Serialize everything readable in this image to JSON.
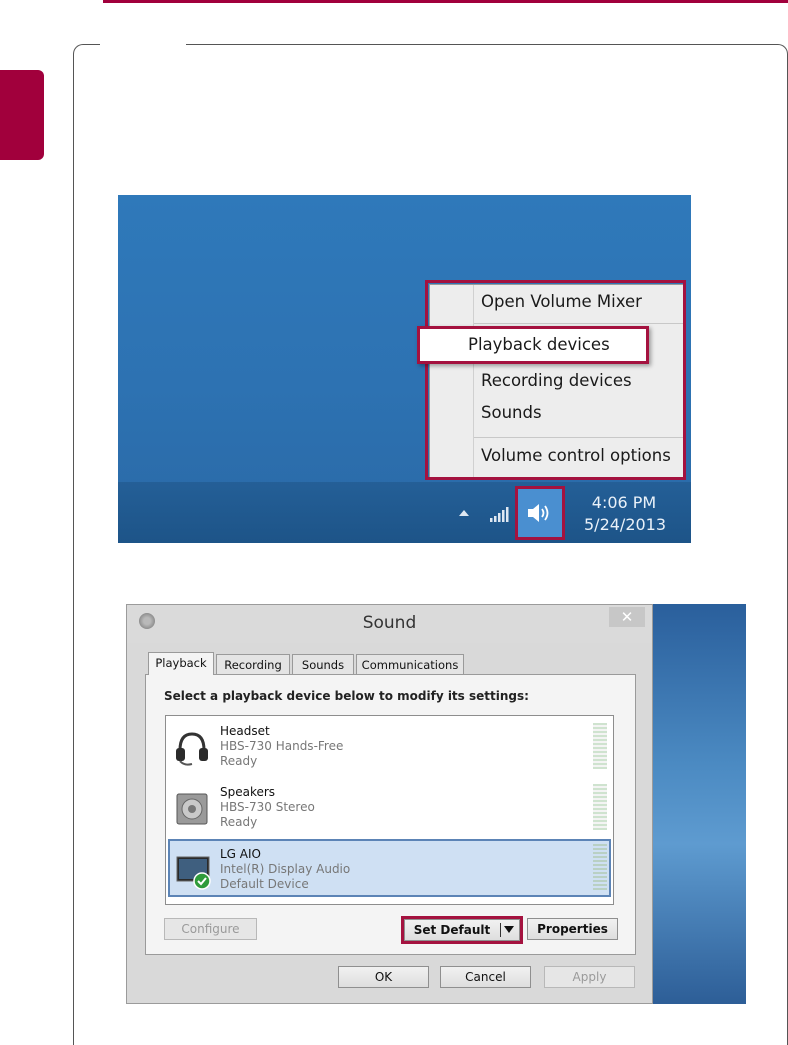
{
  "colors": {
    "accent": "#a1003c",
    "desktop_blue": "#2d72b2"
  },
  "screenshot1": {
    "context_menu": {
      "items": [
        "Open Volume Mixer",
        "Playback devices",
        "Recording devices",
        "Sounds",
        "Volume control options"
      ],
      "highlighted_item": "Playback devices"
    },
    "tray": {
      "time": "4:06 PM",
      "date": "5/24/2013",
      "icons": [
        "show-hidden-icons-arrow",
        "signal-bars-icon",
        "speaker-volume-icon"
      ]
    }
  },
  "sound_dialog": {
    "title": "Sound",
    "close_glyph": "✕",
    "tabs": [
      "Playback",
      "Recording",
      "Sounds",
      "Communications"
    ],
    "active_tab": "Playback",
    "instruction": "Select a playback device below to modify its settings:",
    "devices": [
      {
        "name": "Headset",
        "description": "HBS-730 Hands-Free",
        "status": "Ready",
        "icon": "headset-icon",
        "selected": false
      },
      {
        "name": "Speakers",
        "description": "HBS-730 Stereo",
        "status": "Ready",
        "icon": "speaker-icon",
        "selected": false
      },
      {
        "name": "LG AIO",
        "description": "Intel(R) Display Audio",
        "status": "Default Device",
        "icon": "monitor-icon",
        "selected": true
      }
    ],
    "buttons": {
      "configure": "Configure",
      "set_default": "Set Default",
      "properties": "Properties",
      "ok": "OK",
      "cancel": "Cancel",
      "apply": "Apply"
    }
  }
}
